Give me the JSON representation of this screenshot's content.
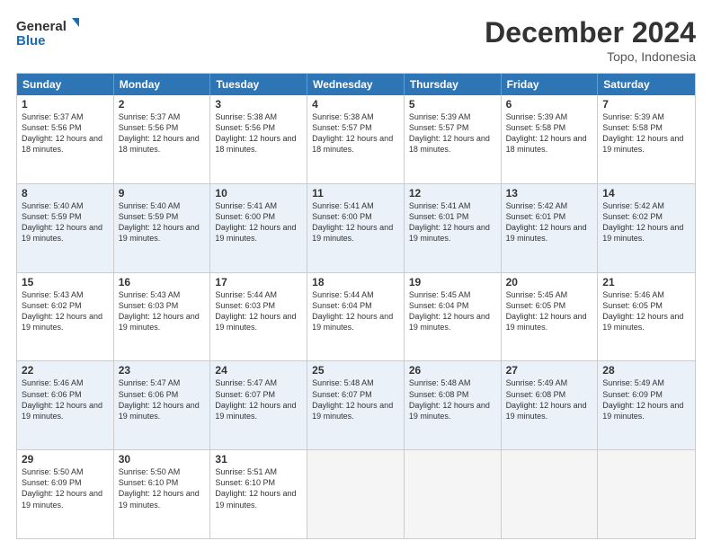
{
  "logo": {
    "line1": "General",
    "line2": "Blue"
  },
  "header": {
    "title": "December 2024",
    "location": "Topo, Indonesia"
  },
  "days_of_week": [
    "Sunday",
    "Monday",
    "Tuesday",
    "Wednesday",
    "Thursday",
    "Friday",
    "Saturday"
  ],
  "weeks": [
    [
      {
        "day": "1",
        "sunrise": "Sunrise: 5:37 AM",
        "sunset": "Sunset: 5:56 PM",
        "daylight": "Daylight: 12 hours and 18 minutes.",
        "empty": false
      },
      {
        "day": "2",
        "sunrise": "Sunrise: 5:37 AM",
        "sunset": "Sunset: 5:56 PM",
        "daylight": "Daylight: 12 hours and 18 minutes.",
        "empty": false
      },
      {
        "day": "3",
        "sunrise": "Sunrise: 5:38 AM",
        "sunset": "Sunset: 5:56 PM",
        "daylight": "Daylight: 12 hours and 18 minutes.",
        "empty": false
      },
      {
        "day": "4",
        "sunrise": "Sunrise: 5:38 AM",
        "sunset": "Sunset: 5:57 PM",
        "daylight": "Daylight: 12 hours and 18 minutes.",
        "empty": false
      },
      {
        "day": "5",
        "sunrise": "Sunrise: 5:39 AM",
        "sunset": "Sunset: 5:57 PM",
        "daylight": "Daylight: 12 hours and 18 minutes.",
        "empty": false
      },
      {
        "day": "6",
        "sunrise": "Sunrise: 5:39 AM",
        "sunset": "Sunset: 5:58 PM",
        "daylight": "Daylight: 12 hours and 18 minutes.",
        "empty": false
      },
      {
        "day": "7",
        "sunrise": "Sunrise: 5:39 AM",
        "sunset": "Sunset: 5:58 PM",
        "daylight": "Daylight: 12 hours and 19 minutes.",
        "empty": false
      }
    ],
    [
      {
        "day": "8",
        "sunrise": "Sunrise: 5:40 AM",
        "sunset": "Sunset: 5:59 PM",
        "daylight": "Daylight: 12 hours and 19 minutes.",
        "empty": false
      },
      {
        "day": "9",
        "sunrise": "Sunrise: 5:40 AM",
        "sunset": "Sunset: 5:59 PM",
        "daylight": "Daylight: 12 hours and 19 minutes.",
        "empty": false
      },
      {
        "day": "10",
        "sunrise": "Sunrise: 5:41 AM",
        "sunset": "Sunset: 6:00 PM",
        "daylight": "Daylight: 12 hours and 19 minutes.",
        "empty": false
      },
      {
        "day": "11",
        "sunrise": "Sunrise: 5:41 AM",
        "sunset": "Sunset: 6:00 PM",
        "daylight": "Daylight: 12 hours and 19 minutes.",
        "empty": false
      },
      {
        "day": "12",
        "sunrise": "Sunrise: 5:41 AM",
        "sunset": "Sunset: 6:01 PM",
        "daylight": "Daylight: 12 hours and 19 minutes.",
        "empty": false
      },
      {
        "day": "13",
        "sunrise": "Sunrise: 5:42 AM",
        "sunset": "Sunset: 6:01 PM",
        "daylight": "Daylight: 12 hours and 19 minutes.",
        "empty": false
      },
      {
        "day": "14",
        "sunrise": "Sunrise: 5:42 AM",
        "sunset": "Sunset: 6:02 PM",
        "daylight": "Daylight: 12 hours and 19 minutes.",
        "empty": false
      }
    ],
    [
      {
        "day": "15",
        "sunrise": "Sunrise: 5:43 AM",
        "sunset": "Sunset: 6:02 PM",
        "daylight": "Daylight: 12 hours and 19 minutes.",
        "empty": false
      },
      {
        "day": "16",
        "sunrise": "Sunrise: 5:43 AM",
        "sunset": "Sunset: 6:03 PM",
        "daylight": "Daylight: 12 hours and 19 minutes.",
        "empty": false
      },
      {
        "day": "17",
        "sunrise": "Sunrise: 5:44 AM",
        "sunset": "Sunset: 6:03 PM",
        "daylight": "Daylight: 12 hours and 19 minutes.",
        "empty": false
      },
      {
        "day": "18",
        "sunrise": "Sunrise: 5:44 AM",
        "sunset": "Sunset: 6:04 PM",
        "daylight": "Daylight: 12 hours and 19 minutes.",
        "empty": false
      },
      {
        "day": "19",
        "sunrise": "Sunrise: 5:45 AM",
        "sunset": "Sunset: 6:04 PM",
        "daylight": "Daylight: 12 hours and 19 minutes.",
        "empty": false
      },
      {
        "day": "20",
        "sunrise": "Sunrise: 5:45 AM",
        "sunset": "Sunset: 6:05 PM",
        "daylight": "Daylight: 12 hours and 19 minutes.",
        "empty": false
      },
      {
        "day": "21",
        "sunrise": "Sunrise: 5:46 AM",
        "sunset": "Sunset: 6:05 PM",
        "daylight": "Daylight: 12 hours and 19 minutes.",
        "empty": false
      }
    ],
    [
      {
        "day": "22",
        "sunrise": "Sunrise: 5:46 AM",
        "sunset": "Sunset: 6:06 PM",
        "daylight": "Daylight: 12 hours and 19 minutes.",
        "empty": false
      },
      {
        "day": "23",
        "sunrise": "Sunrise: 5:47 AM",
        "sunset": "Sunset: 6:06 PM",
        "daylight": "Daylight: 12 hours and 19 minutes.",
        "empty": false
      },
      {
        "day": "24",
        "sunrise": "Sunrise: 5:47 AM",
        "sunset": "Sunset: 6:07 PM",
        "daylight": "Daylight: 12 hours and 19 minutes.",
        "empty": false
      },
      {
        "day": "25",
        "sunrise": "Sunrise: 5:48 AM",
        "sunset": "Sunset: 6:07 PM",
        "daylight": "Daylight: 12 hours and 19 minutes.",
        "empty": false
      },
      {
        "day": "26",
        "sunrise": "Sunrise: 5:48 AM",
        "sunset": "Sunset: 6:08 PM",
        "daylight": "Daylight: 12 hours and 19 minutes.",
        "empty": false
      },
      {
        "day": "27",
        "sunrise": "Sunrise: 5:49 AM",
        "sunset": "Sunset: 6:08 PM",
        "daylight": "Daylight: 12 hours and 19 minutes.",
        "empty": false
      },
      {
        "day": "28",
        "sunrise": "Sunrise: 5:49 AM",
        "sunset": "Sunset: 6:09 PM",
        "daylight": "Daylight: 12 hours and 19 minutes.",
        "empty": false
      }
    ],
    [
      {
        "day": "29",
        "sunrise": "Sunrise: 5:50 AM",
        "sunset": "Sunset: 6:09 PM",
        "daylight": "Daylight: 12 hours and 19 minutes.",
        "empty": false
      },
      {
        "day": "30",
        "sunrise": "Sunrise: 5:50 AM",
        "sunset": "Sunset: 6:10 PM",
        "daylight": "Daylight: 12 hours and 19 minutes.",
        "empty": false
      },
      {
        "day": "31",
        "sunrise": "Sunrise: 5:51 AM",
        "sunset": "Sunset: 6:10 PM",
        "daylight": "Daylight: 12 hours and 19 minutes.",
        "empty": false
      },
      {
        "day": "",
        "sunrise": "",
        "sunset": "",
        "daylight": "",
        "empty": true
      },
      {
        "day": "",
        "sunrise": "",
        "sunset": "",
        "daylight": "",
        "empty": true
      },
      {
        "day": "",
        "sunrise": "",
        "sunset": "",
        "daylight": "",
        "empty": true
      },
      {
        "day": "",
        "sunrise": "",
        "sunset": "",
        "daylight": "",
        "empty": true
      }
    ]
  ]
}
